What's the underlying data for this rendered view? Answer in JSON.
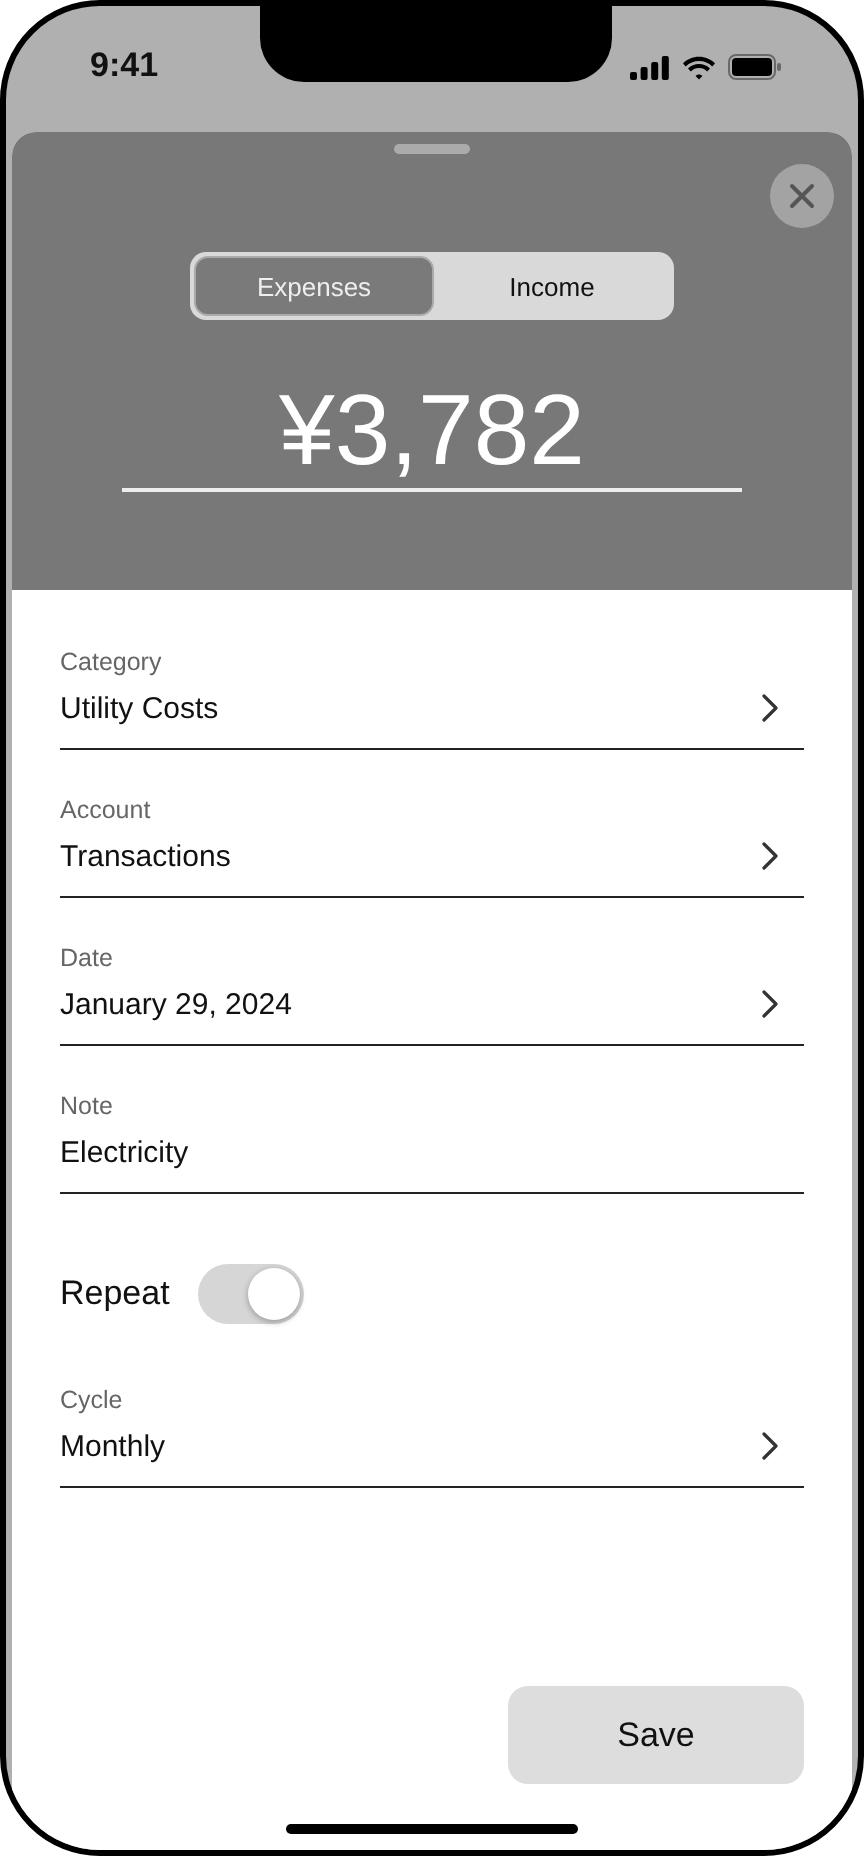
{
  "status_bar": {
    "time": "9:41"
  },
  "type_switch": {
    "tabs": [
      {
        "label": "Expenses",
        "selected": true
      },
      {
        "label": "Income",
        "selected": false
      }
    ]
  },
  "amount": "¥3,782",
  "fields": [
    {
      "kind": "select",
      "label": "Category",
      "value": "Utility Costs"
    },
    {
      "kind": "select",
      "label": "Account",
      "value": "Transactions"
    },
    {
      "kind": "select",
      "label": "Date",
      "value": "January 29, 2024"
    },
    {
      "kind": "text",
      "label": "Note",
      "value": "Electricity"
    },
    {
      "kind": "toggle",
      "label": "Repeat",
      "on": true
    },
    {
      "kind": "select",
      "label": "Cycle",
      "value": "Monthly"
    }
  ],
  "save_button": "Save"
}
